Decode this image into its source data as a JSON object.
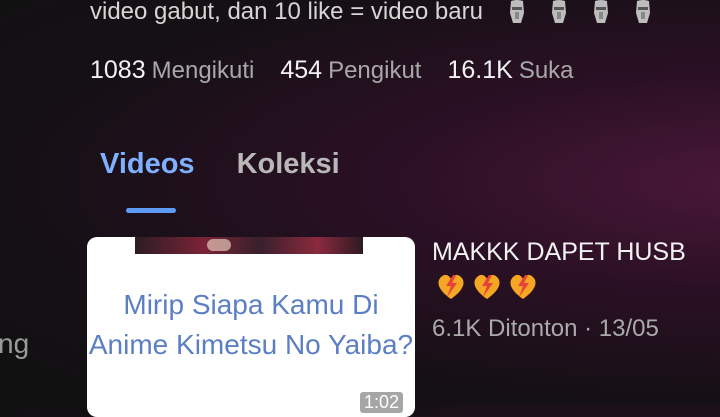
{
  "profile": {
    "bio": "video gabut, dan 10 like = video baru",
    "bio_emojis": [
      "moai-icon",
      "moai-icon",
      "moai-icon",
      "moai-icon"
    ],
    "stats": [
      {
        "value": "1083",
        "label": "Mengikuti"
      },
      {
        "value": "454",
        "label": "Pengikut"
      },
      {
        "value": "16.1K",
        "label": "Suka"
      }
    ]
  },
  "tabs": [
    {
      "label": "Videos",
      "active": true
    },
    {
      "label": "Koleksi",
      "active": false
    }
  ],
  "side": {
    "text": "ng"
  },
  "video": {
    "thumbnail_title": "Mirip Siapa Kamu Di Anime Kimetsu No Yaiba?",
    "duration": "1:02",
    "title": "MAKKK DAPET HUSB",
    "title_emojis": [
      "lightning-heart-icon",
      "lightning-heart-icon",
      "lightning-heart-icon"
    ],
    "views": "6.1K Ditonton",
    "date": "13/05"
  },
  "colors": {
    "accent": "#5d9bf5",
    "active_tab": "#7fb0ff",
    "thumbnail_text": "#5b7fc2"
  }
}
